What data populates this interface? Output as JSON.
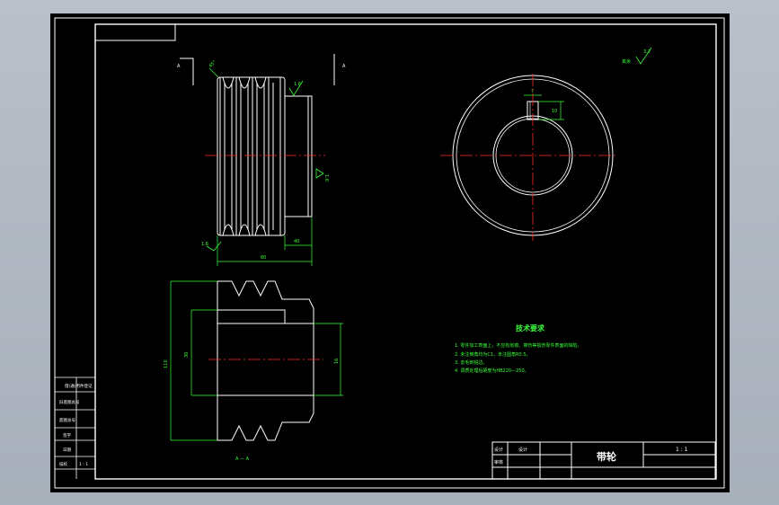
{
  "colors": {
    "window_bg": "#b4bbc5",
    "paper": "#000000",
    "line": "#ffffff",
    "centerline": "#ff2a2a",
    "dimension": "#39ff39",
    "text_green": "#39ff39",
    "text_white": "#ffffff"
  },
  "drawing": {
    "side_view": {
      "section_mark_left": "A",
      "section_mark_right": "A",
      "chamfer_label": "45°",
      "roughness_top": "1.6",
      "roughness_side": "1.6",
      "roughness_bottom": "1.6",
      "dim_hub_width": "40",
      "dim_total_width": "80"
    },
    "front_view": {
      "keyway_width": "7",
      "keyway_depth": "10",
      "roughness_label": "其余",
      "roughness_value": "3.2"
    },
    "section_view": {
      "dim_outer_dia": "110",
      "dim_bore_dia": "30",
      "dim_hub_dia": "16",
      "section_label": "A — A"
    },
    "tech_requirements": {
      "title": "技术要求",
      "items": [
        "1. 零件加工表面上，不应有划痕、擦伤等损伤零件表面的缺陷。",
        "2. 未注倒角均为C1，未注圆角R0.5。",
        "3. 去毛刺锐边。",
        "4. 调质处理后硬度为HB220—250。"
      ]
    },
    "left_strip": {
      "cells": [
        "借(通)用件登记",
        "旧底图总号",
        "底图总号",
        "签字",
        "日期",
        "描校",
        "1 : 1"
      ]
    },
    "title_block": {
      "designer_label": "设计",
      "checker_label": "审核",
      "designer_name": "设计",
      "part_name": "带轮",
      "scale": "1 : 1"
    }
  }
}
